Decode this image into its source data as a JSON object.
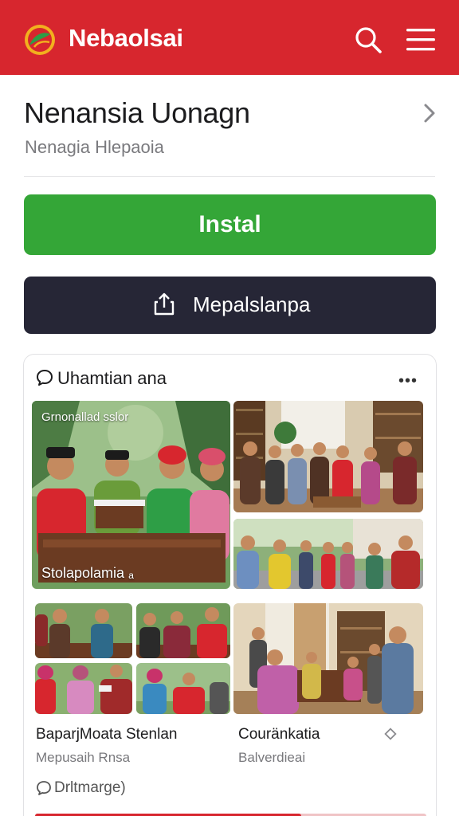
{
  "header": {
    "brand": "Nebaolsai",
    "logo_icon": "leaf-logo-icon",
    "search_icon": "search-icon",
    "menu_icon": "hamburger-menu-icon",
    "color": "#d7262e"
  },
  "app": {
    "title": "Nenansia Uonagn",
    "subtitle": "Nenagia Hlepaoia",
    "chevron_icon": "chevron-right-icon"
  },
  "actions": {
    "install_label": "Instal",
    "install_color": "#34a637",
    "share_label": "Mepalslanpa",
    "share_icon": "share-icon",
    "share_color": "#262636"
  },
  "gallery": {
    "title": "Uhamtian ana",
    "title_icon": "chat-bubble-icon",
    "more_label": "•••",
    "featured_top_text": "Grnonallad sslor",
    "featured_bottom_text": "Stolapolamia ₐ",
    "captions": [
      {
        "title": "BaparjMoata Stenlan",
        "subtitle": "Mepusaih   Rnsa"
      },
      {
        "title": "Couränkatia",
        "subtitle": "Balverdieai"
      }
    ],
    "comment_label": "Drltmarge)",
    "comment_icon": "comment-icon",
    "progress": 0.68
  }
}
